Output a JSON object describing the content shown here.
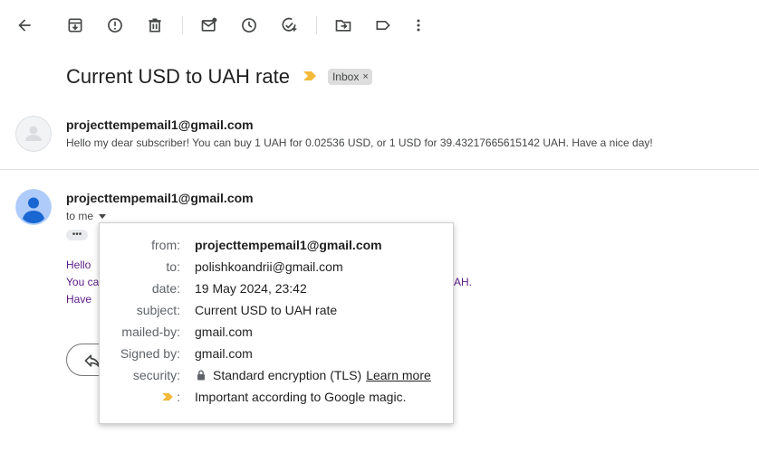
{
  "toolbar": {
    "buttons": [
      "back-icon",
      "archive-icon",
      "report-spam-icon",
      "delete-icon",
      "mark-unread-icon",
      "snooze-icon",
      "add-to-tasks-icon",
      "move-to-icon",
      "label-icon",
      "more-icon"
    ]
  },
  "email": {
    "subject": "Current USD to UAH rate",
    "label_chip": "Inbox",
    "label_remove": "×"
  },
  "message1": {
    "sender": "projecttempemail1@gmail.com",
    "snippet": "Hello my dear subscriber! You can buy 1 UAH for 0.02536 USD, or 1 USD for 39.43217665615142 UAH. Have a nice day!"
  },
  "message2": {
    "sender": "projecttempemail1@gmail.com",
    "to": "to me",
    "dots": "•••",
    "body_lines": [
      "Hello",
      "You ca",
      "Have"
    ],
    "body_end": "AH."
  },
  "details_popup": {
    "from_label": "from:",
    "from_value": "projecttempemail1@gmail.com",
    "to_label": "to:",
    "to_value": "polishkoandrii@gmail.com",
    "date_label": "date:",
    "date_value": "19 May 2024, 23:42",
    "subject_label": "subject:",
    "subject_value": "Current USD to UAH rate",
    "mailedby_label": "mailed-by:",
    "mailedby_value": "gmail.com",
    "signedby_label": "Signed by:",
    "signedby_value": "gmail.com",
    "security_label": "security:",
    "security_value": "Standard encryption (TLS)",
    "learn_more": "Learn more",
    "importance_label": ":",
    "importance_value": "Important according to Google magic."
  },
  "colors": {
    "importance_marker": "#f2b93b",
    "avatar_blue": "#aecbfa",
    "avatar_figure": "#1967d2",
    "body_text": "#5b1a86"
  }
}
